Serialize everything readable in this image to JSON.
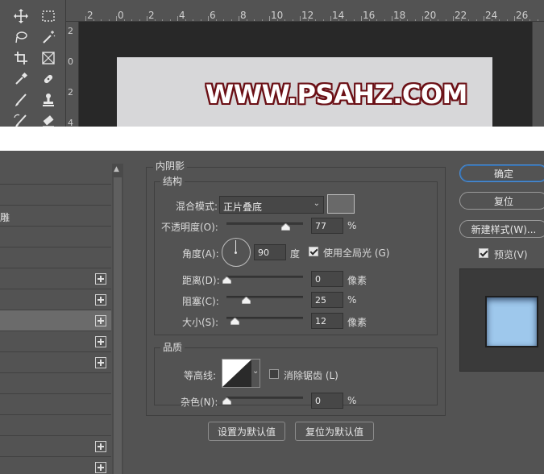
{
  "doc_text": "WWW.PSAHZ.COM",
  "ruler_top_labels": [
    "2",
    "0",
    "2",
    "4",
    "6",
    "8",
    "10",
    "12",
    "14",
    "16",
    "18",
    "20",
    "22",
    "24",
    "26"
  ],
  "ruler_left_labels": [
    "2",
    "0",
    "2",
    "4"
  ],
  "tools": [
    {
      "icon": "move-icon"
    },
    {
      "icon": "marquee-icon"
    },
    {
      "icon": "lasso-icon"
    },
    {
      "icon": "magic-wand-icon"
    },
    {
      "icon": "crop-icon"
    },
    {
      "icon": "frame-icon"
    },
    {
      "icon": "eyedropper-icon"
    },
    {
      "icon": "healing-brush-icon"
    },
    {
      "icon": "brush-icon"
    },
    {
      "icon": "stamp-icon"
    },
    {
      "icon": "history-brush-icon"
    },
    {
      "icon": "eraser-icon"
    }
  ],
  "styles_list": [
    {
      "label": ""
    },
    {
      "label": ""
    },
    {
      "label": "雕"
    },
    {
      "label": ""
    },
    {
      "label": ""
    },
    {
      "label": "",
      "plus": true
    },
    {
      "label": "",
      "plus": true
    },
    {
      "label": "",
      "plus": true,
      "selected": true
    },
    {
      "label": "",
      "plus": true
    },
    {
      "label": "",
      "plus": true
    },
    {
      "label": ""
    },
    {
      "label": ""
    },
    {
      "label": ""
    },
    {
      "label": "",
      "plus": true
    },
    {
      "label": "",
      "plus": true
    }
  ],
  "panel": {
    "title": "内阴影",
    "structure": {
      "title": "结构",
      "blend_mode_label": "混合模式:",
      "blend_mode_value": "正片叠底",
      "shadow_color": "#696969",
      "opacity_label": "不透明度(O):",
      "opacity_value": "77",
      "opacity_unit": "%",
      "opacity_fraction": 0.77,
      "angle_label": "角度(A):",
      "angle_value": "90",
      "angle_unit": "度",
      "global_light_label": "使用全局光 (G)",
      "global_light_checked": true,
      "distance_label": "距离(D):",
      "distance_value": "0",
      "distance_unit": "像素",
      "distance_fraction": 0.0,
      "choke_label": "阻塞(C):",
      "choke_value": "25",
      "choke_unit": "%",
      "choke_fraction": 0.25,
      "size_label": "大小(S):",
      "size_value": "12",
      "size_unit": "像素",
      "size_fraction": 0.1
    },
    "quality": {
      "title": "品质",
      "contour_label": "等高线:",
      "antialias_label": "消除锯齿 (L)",
      "antialias_checked": false,
      "noise_label": "杂色(N):",
      "noise_value": "0",
      "noise_unit": "%",
      "noise_fraction": 0.0
    },
    "make_default_label": "设置为默认值",
    "reset_default_label": "复位为默认值"
  },
  "buttons": {
    "ok": "确定",
    "reset": "复位",
    "new_style": "新建样式(W)...",
    "preview_label": "预览(V)",
    "preview_checked": true
  },
  "colors": {
    "accent": "#4d8fd6",
    "preview_swatch": "#9ec8ec",
    "doc_text_outline": "#6b1016"
  }
}
